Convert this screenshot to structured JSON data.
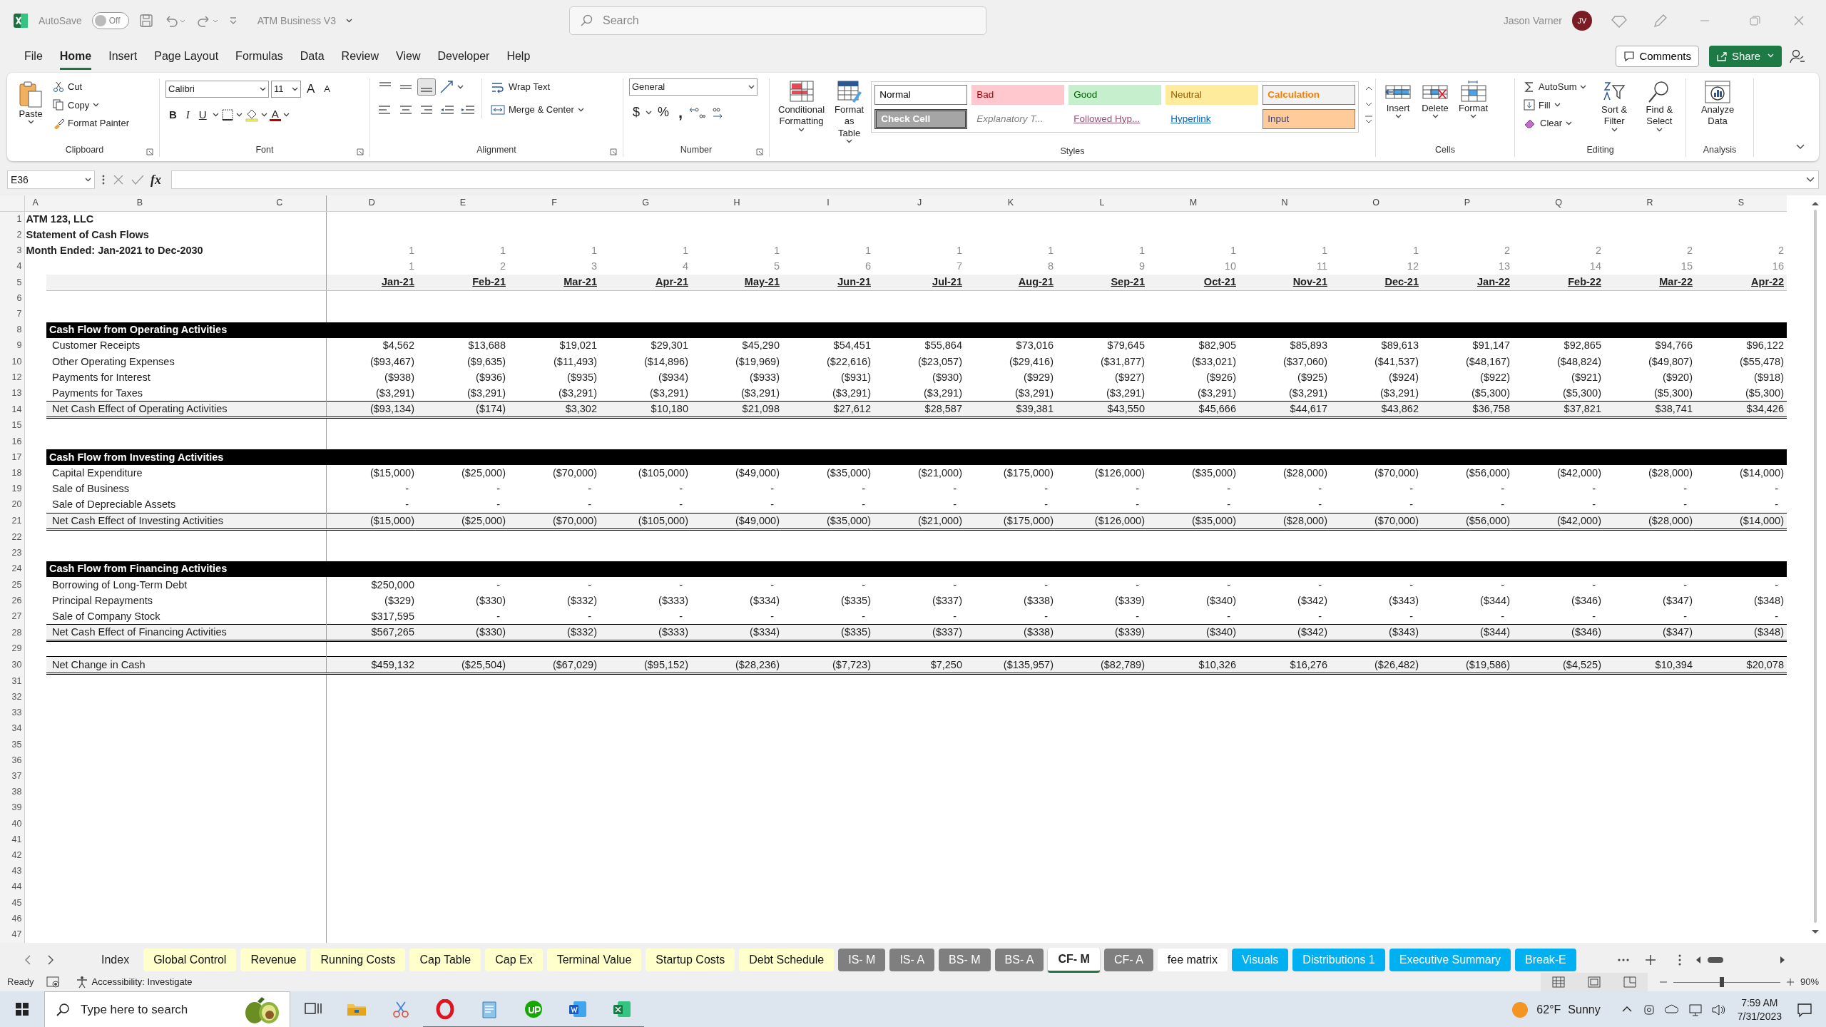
{
  "title_bar": {
    "autosave_label": "AutoSave",
    "autosave_on": false,
    "autosave_state": "Off",
    "file_name": "ATM Business V3",
    "search": {
      "placeholder": "Search"
    },
    "user": "Jason Varner",
    "avatar": "JV"
  },
  "menu_tabs": [
    {
      "label": "File",
      "selected": false
    },
    {
      "label": "Home",
      "selected": true
    },
    {
      "label": "Insert",
      "selected": false
    },
    {
      "label": "Page Layout",
      "selected": false
    },
    {
      "label": "Formulas",
      "selected": false
    },
    {
      "label": "Data",
      "selected": false
    },
    {
      "label": "Review",
      "selected": false
    },
    {
      "label": "View",
      "selected": false
    },
    {
      "label": "Developer",
      "selected": false
    },
    {
      "label": "Help",
      "selected": false
    }
  ],
  "actions": {
    "comments": "Comments",
    "share": "Share"
  },
  "ribbon": [
    {
      "kind": "clipboard",
      "label": "Clipboard",
      "paste": "Paste",
      "cut": "Cut",
      "copy": "Copy",
      "painter": "Format Painter"
    },
    {
      "kind": "font",
      "label": "Font",
      "font_name": "Calibri",
      "font_size": "11",
      "grow": "A",
      "shrink": "A",
      "bold": "B",
      "italic": "I",
      "underline": "U",
      "font_color": "A"
    },
    {
      "kind": "alignment",
      "label": "Alignment",
      "wrap": "Wrap Text",
      "merge": "Merge & Center"
    },
    {
      "kind": "number",
      "label": "Number",
      "format": "General",
      "currency": "$",
      "percent": "%",
      "comma": ","
    },
    {
      "kind": "styles",
      "label": "Styles",
      "conditional": "Conditional Formatting",
      "table": "Format as Table",
      "items": [
        {
          "label": "Normal",
          "kind": "normal"
        },
        {
          "label": "Bad",
          "kind": "bad"
        },
        {
          "label": "Good",
          "kind": "good"
        },
        {
          "label": "Neutral",
          "kind": "neutral"
        },
        {
          "label": "Calculation",
          "kind": "calculation"
        },
        {
          "label": "Check Cell",
          "kind": "check"
        },
        {
          "label": "Explanatory T...",
          "kind": "explanatory"
        },
        {
          "label": "Followed Hyp...",
          "kind": "followed"
        },
        {
          "label": "Hyperlink",
          "kind": "hyperlink"
        },
        {
          "label": "Input",
          "kind": "input"
        }
      ]
    },
    {
      "kind": "cells",
      "label": "Cells",
      "buttons": [
        "Insert",
        "Delete",
        "Format"
      ]
    },
    {
      "kind": "editing",
      "label": "Editing",
      "autosum": "AutoSum",
      "fill": "Fill",
      "clear": "Clear",
      "sort": "Sort & Filter",
      "find": "Find & Select"
    },
    {
      "kind": "analysis",
      "label": "Analysis",
      "button": "Analyze Data"
    }
  ],
  "formula_bar": {
    "name_box": "E36",
    "function_label": "fx"
  },
  "columns": [
    "A",
    "B",
    "C",
    "D",
    "E",
    "F",
    "G",
    "H",
    "I",
    "J",
    "K",
    "L",
    "M",
    "N",
    "O",
    "P",
    "Q",
    "R",
    "S"
  ],
  "rows": [
    {
      "n": "1",
      "kind": "title",
      "label": "ATM 123, LLC"
    },
    {
      "n": "2",
      "kind": "title",
      "label": "Statement of Cash Flows"
    },
    {
      "n": "3",
      "kind": "title",
      "label": "Month Ended: Jan-2021 to Dec-2030",
      "values": [
        "1",
        "1",
        "1",
        "1",
        "1",
        "1",
        "1",
        "1",
        "1",
        "1",
        "1",
        "1",
        "2",
        "2",
        "2",
        "2"
      ]
    },
    {
      "n": "4",
      "kind": "counter",
      "values": [
        "1",
        "2",
        "3",
        "4",
        "5",
        "6",
        "7",
        "8",
        "9",
        "10",
        "11",
        "12",
        "13",
        "14",
        "15",
        "16"
      ]
    },
    {
      "n": "5",
      "kind": "dates",
      "values": [
        "Jan-21",
        "Feb-21",
        "Mar-21",
        "Apr-21",
        "May-21",
        "Jun-21",
        "Jul-21",
        "Aug-21",
        "Sep-21",
        "Oct-21",
        "Nov-21",
        "Dec-21",
        "Jan-22",
        "Feb-22",
        "Mar-22",
        "Apr-22"
      ]
    },
    {
      "n": "6",
      "kind": "blank"
    },
    {
      "n": "7",
      "kind": "blank"
    },
    {
      "n": "8",
      "kind": "section",
      "label": "Cash Flow from Operating Activities"
    },
    {
      "n": "9",
      "kind": "item",
      "label": "Customer Receipts",
      "values": [
        "$4,562",
        "$13,688",
        "$19,021",
        "$29,301",
        "$45,290",
        "$54,451",
        "$55,864",
        "$73,016",
        "$79,645",
        "$82,905",
        "$85,893",
        "$89,613",
        "$91,147",
        "$92,865",
        "$94,766",
        "$96,122"
      ]
    },
    {
      "n": "10",
      "kind": "item",
      "label": "Other Operating Expenses",
      "values": [
        "($93,467)",
        "($9,635)",
        "($11,493)",
        "($14,896)",
        "($19,969)",
        "($22,616)",
        "($23,057)",
        "($29,416)",
        "($31,877)",
        "($33,021)",
        "($37,060)",
        "($41,537)",
        "($48,167)",
        "($48,824)",
        "($49,807)",
        "($55,478)"
      ]
    },
    {
      "n": "12",
      "kind": "item",
      "label": "Payments for Interest",
      "values": [
        "($938)",
        "($936)",
        "($935)",
        "($934)",
        "($933)",
        "($931)",
        "($930)",
        "($929)",
        "($927)",
        "($926)",
        "($925)",
        "($924)",
        "($922)",
        "($921)",
        "($920)",
        "($918)"
      ]
    },
    {
      "n": "13",
      "kind": "item",
      "label": "Payments for Taxes",
      "values": [
        "($3,291)",
        "($3,291)",
        "($3,291)",
        "($3,291)",
        "($3,291)",
        "($3,291)",
        "($3,291)",
        "($3,291)",
        "($3,291)",
        "($3,291)",
        "($3,291)",
        "($3,291)",
        "($5,300)",
        "($5,300)",
        "($5,300)",
        "($5,300)"
      ]
    },
    {
      "n": "14",
      "kind": "total",
      "label": "Net Cash Effect of Operating Activities",
      "values": [
        "($93,134)",
        "($174)",
        "$3,302",
        "$10,180",
        "$21,098",
        "$27,612",
        "$28,587",
        "$39,381",
        "$43,550",
        "$45,666",
        "$44,617",
        "$43,862",
        "$36,758",
        "$37,821",
        "$38,741",
        "$34,426"
      ]
    },
    {
      "n": "15",
      "kind": "blank"
    },
    {
      "n": "16",
      "kind": "blank"
    },
    {
      "n": "17",
      "kind": "section",
      "label": "Cash Flow from Investing Activities"
    },
    {
      "n": "18",
      "kind": "item",
      "label": "Capital Expenditure",
      "values": [
        "($15,000)",
        "($25,000)",
        "($70,000)",
        "($105,000)",
        "($49,000)",
        "($35,000)",
        "($21,000)",
        "($175,000)",
        "($126,000)",
        "($35,000)",
        "($28,000)",
        "($70,000)",
        "($56,000)",
        "($42,000)",
        "($28,000)",
        "($14,000)"
      ]
    },
    {
      "n": "19",
      "kind": "item",
      "label": "Sale of Business",
      "values": [
        "-",
        "-",
        "-",
        "-",
        "-",
        "-",
        "-",
        "-",
        "-",
        "-",
        "-",
        "-",
        "-",
        "-",
        "-",
        "-"
      ]
    },
    {
      "n": "20",
      "kind": "item",
      "label": "Sale of Depreciable Assets",
      "values": [
        "-",
        "-",
        "-",
        "-",
        "-",
        "-",
        "-",
        "-",
        "-",
        "-",
        "-",
        "-",
        "-",
        "-",
        "-",
        "-"
      ]
    },
    {
      "n": "21",
      "kind": "total",
      "label": "Net Cash Effect of Investing Activities",
      "values": [
        "($15,000)",
        "($25,000)",
        "($70,000)",
        "($105,000)",
        "($49,000)",
        "($35,000)",
        "($21,000)",
        "($175,000)",
        "($126,000)",
        "($35,000)",
        "($28,000)",
        "($70,000)",
        "($56,000)",
        "($42,000)",
        "($28,000)",
        "($14,000)"
      ]
    },
    {
      "n": "22",
      "kind": "blank"
    },
    {
      "n": "23",
      "kind": "blank"
    },
    {
      "n": "24",
      "kind": "section",
      "label": "Cash Flow from Financing Activities"
    },
    {
      "n": "25",
      "kind": "item",
      "label": "Borrowing of Long-Term Debt",
      "values": [
        "$250,000",
        "-",
        "-",
        "-",
        "-",
        "-",
        "-",
        "-",
        "-",
        "-",
        "-",
        "-",
        "-",
        "-",
        "-",
        "-"
      ]
    },
    {
      "n": "26",
      "kind": "item",
      "label": "Principal Repayments",
      "values": [
        "($329)",
        "($330)",
        "($332)",
        "($333)",
        "($334)",
        "($335)",
        "($337)",
        "($338)",
        "($339)",
        "($340)",
        "($342)",
        "($343)",
        "($344)",
        "($346)",
        "($347)",
        "($348)"
      ]
    },
    {
      "n": "27",
      "kind": "item",
      "label": "Sale of Company Stock",
      "values": [
        "$317,595",
        "-",
        "-",
        "-",
        "-",
        "-",
        "-",
        "-",
        "-",
        "-",
        "-",
        "-",
        "-",
        "-",
        "-",
        "-"
      ]
    },
    {
      "n": "28",
      "kind": "total",
      "label": "Net Cash Effect of Financing Activities",
      "values": [
        "$567,265",
        "($330)",
        "($332)",
        "($333)",
        "($334)",
        "($335)",
        "($337)",
        "($338)",
        "($339)",
        "($340)",
        "($342)",
        "($343)",
        "($344)",
        "($346)",
        "($347)",
        "($348)"
      ]
    },
    {
      "n": "29",
      "kind": "blank"
    },
    {
      "n": "30",
      "kind": "total",
      "label": "Net Change in Cash",
      "values": [
        "$459,132",
        "($25,504)",
        "($67,029)",
        "($95,152)",
        "($28,236)",
        "($7,723)",
        "$7,250",
        "($135,957)",
        "($82,789)",
        "$10,326",
        "$16,276",
        "($26,482)",
        "($19,586)",
        "($4,525)",
        "$10,394",
        "$20,078"
      ]
    },
    {
      "n": "31",
      "kind": "blank"
    },
    {
      "n": "32",
      "kind": "blank"
    },
    {
      "n": "33",
      "kind": "blank"
    },
    {
      "n": "34",
      "kind": "blank"
    },
    {
      "n": "35",
      "kind": "blank"
    },
    {
      "n": "36",
      "kind": "blank"
    },
    {
      "n": "37",
      "kind": "blank"
    },
    {
      "n": "38",
      "kind": "blank"
    },
    {
      "n": "39",
      "kind": "blank"
    },
    {
      "n": "40",
      "kind": "blank"
    },
    {
      "n": "41",
      "kind": "blank"
    },
    {
      "n": "42",
      "kind": "blank"
    },
    {
      "n": "43",
      "kind": "blank"
    },
    {
      "n": "44",
      "kind": "blank"
    },
    {
      "n": "45",
      "kind": "blank"
    },
    {
      "n": "46",
      "kind": "blank"
    },
    {
      "n": "47",
      "kind": "blank"
    }
  ],
  "sheet_tabs": [
    {
      "label": "Index",
      "selected": false
    },
    {
      "label": "Global Control",
      "color": "#ffffcc",
      "selected": false
    },
    {
      "label": "Revenue",
      "color": "#ffffcc",
      "selected": false
    },
    {
      "label": "Running Costs",
      "color": "#ffffcc",
      "selected": false
    },
    {
      "label": "Cap Table",
      "color": "#ffffcc",
      "selected": false
    },
    {
      "label": "Cap Ex",
      "color": "#ffffcc",
      "selected": false
    },
    {
      "label": "Terminal Value",
      "color": "#ffffcc",
      "selected": false
    },
    {
      "label": "Startup Costs",
      "color": "#ffffcc",
      "selected": false
    },
    {
      "label": "Debt Schedule",
      "color": "#ffffcc",
      "selected": false
    },
    {
      "label": "IS- M",
      "color": "#7f7f7f",
      "selected": false
    },
    {
      "label": "IS- A",
      "color": "#7f7f7f",
      "selected": false
    },
    {
      "label": "BS- M",
      "color": "#7f7f7f",
      "selected": false
    },
    {
      "label": "BS- A",
      "color": "#7f7f7f",
      "selected": false
    },
    {
      "label": "CF- M",
      "selected": true
    },
    {
      "label": "CF- A",
      "color": "#7f7f7f",
      "selected": false
    },
    {
      "label": "fee matrix",
      "color": "#ffffff",
      "selected": false
    },
    {
      "label": "Visuals",
      "color": "#00b0f0",
      "selected": false
    },
    {
      "label": "Distributions 1",
      "color": "#00b0f0",
      "selected": false
    },
    {
      "label": "Executive Summary",
      "color": "#00b0f0",
      "selected": false
    },
    {
      "label": "Break-E",
      "color": "#00b0f0",
      "selected": false
    }
  ],
  "status_bar": {
    "mode": "Ready",
    "accessibility": "Accessibility: Investigate",
    "zoom": "90%",
    "zoom_slider": {
      "level": 0.45
    }
  },
  "taskbar": {
    "search": {
      "placeholder": "Type here to search"
    },
    "temperature": "62°F",
    "weather": "Sunny",
    "time": "7:59 AM",
    "date": "7/31/2023"
  }
}
